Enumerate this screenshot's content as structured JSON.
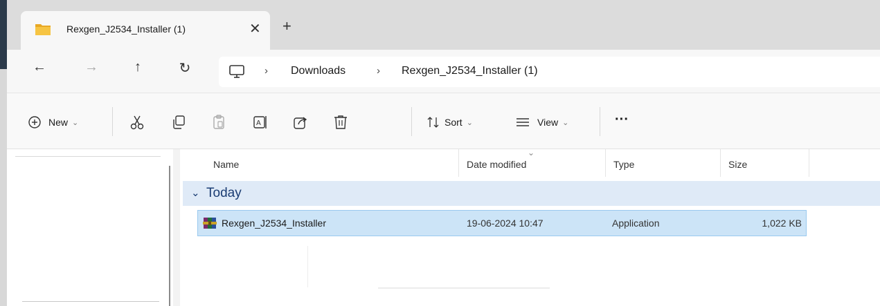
{
  "tab": {
    "title": "Rexgen_J2534_Installer (1)",
    "close_glyph": "✕",
    "new_tab_glyph": "+",
    "icon": "folder-icon"
  },
  "nav": {
    "back": "←",
    "forward": "→",
    "up": "↑",
    "refresh": "↻"
  },
  "breadcrumb": {
    "root_icon": "this-pc-icon",
    "separator": "›",
    "items": [
      "Downloads",
      "Rexgen_J2534_Installer (1)"
    ]
  },
  "commands": {
    "new_label": "New",
    "sort_label": "Sort",
    "view_label": "View",
    "more_label": "···",
    "dropdown_glyph": "⌄",
    "icons": [
      "new-icon",
      "cut-icon",
      "copy-icon",
      "paste-icon",
      "rename-icon",
      "share-icon",
      "delete-icon",
      "sort-icon",
      "view-icon"
    ]
  },
  "columns": {
    "name": "Name",
    "date": "Date modified",
    "type": "Type",
    "size": "Size"
  },
  "group": {
    "label": "Today",
    "chevron": "⌄"
  },
  "files": [
    {
      "name": "Rexgen_J2534_Installer",
      "date": "19-06-2024 10:47",
      "type": "Application",
      "size": "1,022 KB",
      "icon": "winrar-sfx-icon"
    }
  ],
  "colors": {
    "selected_row": "#cce4f7",
    "group_row": "#dfeaf7",
    "group_text": "#1a3c73",
    "folder": "#f6c443"
  }
}
